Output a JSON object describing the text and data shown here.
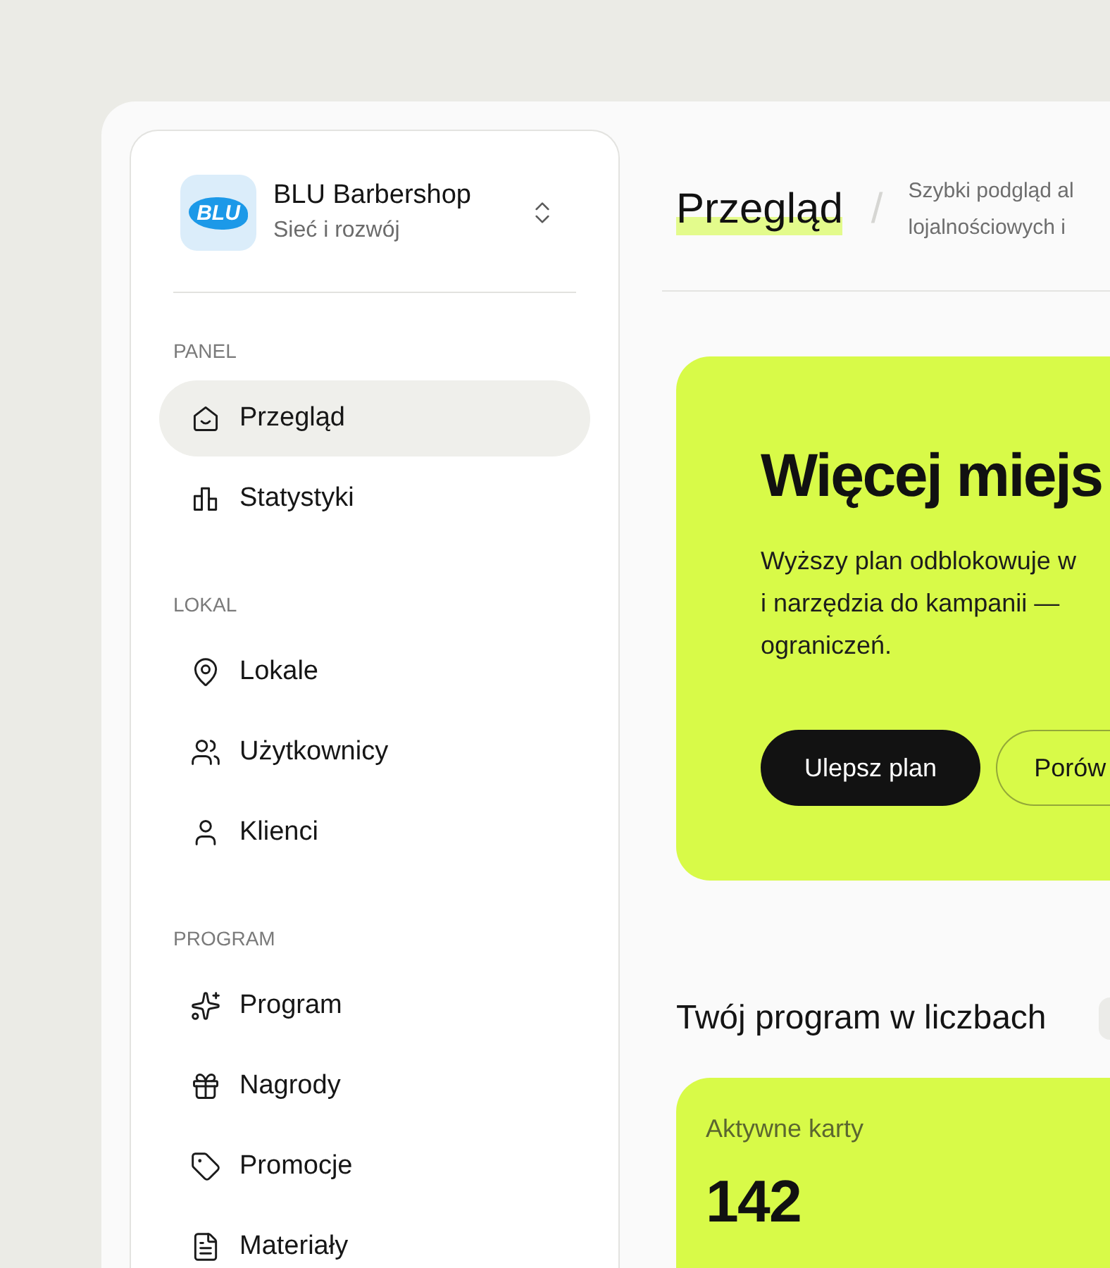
{
  "sidebar": {
    "brand": {
      "logo_text": "BLU",
      "name": "BLU Barbershop",
      "subtitle": "Sieć i rozwój"
    },
    "sections": [
      {
        "title": "PANEL",
        "items": [
          {
            "label": "Przegląd",
            "selected": true
          },
          {
            "label": "Statystyki",
            "selected": false
          }
        ]
      },
      {
        "title": "LOKAL",
        "items": [
          {
            "label": "Lokale",
            "selected": false
          },
          {
            "label": "Użytkownicy",
            "selected": false
          },
          {
            "label": "Klienci",
            "selected": false
          }
        ]
      },
      {
        "title": "PROGRAM",
        "items": [
          {
            "label": "Program",
            "selected": false
          },
          {
            "label": "Nagrody",
            "selected": false
          },
          {
            "label": "Promocje",
            "selected": false
          },
          {
            "label": "Materiały",
            "selected": false
          }
        ]
      }
    ]
  },
  "header": {
    "title": "Przegląd",
    "separator": "/",
    "subtitle_lines": [
      "Szybki podgląd al",
      "lojalnościowych i"
    ]
  },
  "hero": {
    "heading": "Więcej miejs",
    "description_lines": [
      "Wyższy plan odblokowuje w",
      "i narzędzia do kampanii —",
      "ograniczeń."
    ],
    "buttons": [
      {
        "label": "Ulepsz plan",
        "kind": "primary"
      },
      {
        "label": "Porów",
        "kind": "outline"
      }
    ]
  },
  "stats": {
    "title": "Twój program w liczbach",
    "cards": [
      {
        "label": "Aktywne karty",
        "value": "142"
      }
    ]
  }
}
